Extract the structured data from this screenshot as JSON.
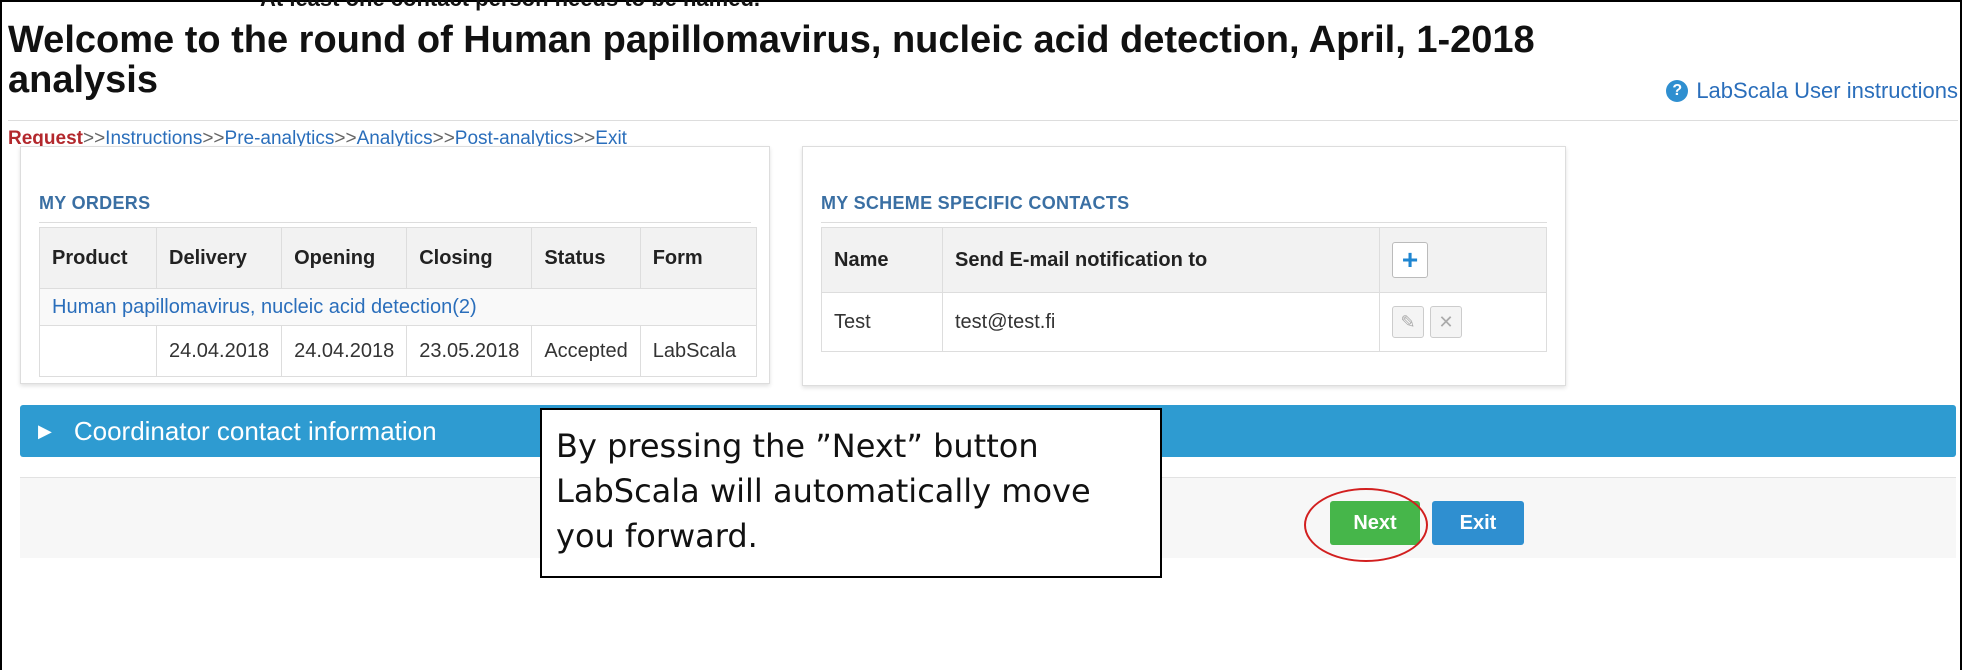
{
  "page": {
    "cut_note": "At least one contact person needs to be named.",
    "title": "Welcome to the round of Human papillomavirus, nucleic acid detection, April, 1-2018 analysis",
    "help_link": "LabScala User instructions"
  },
  "breadcrumb": {
    "active": "Request",
    "separator": ">>",
    "items": [
      "Instructions",
      "Pre-analytics",
      "Analytics",
      "Post-analytics",
      "Exit"
    ]
  },
  "orders": {
    "heading": "MY ORDERS",
    "columns": [
      "Product",
      "Delivery",
      "Opening",
      "Closing",
      "Status",
      "Form"
    ],
    "product_name": "Human papillomavirus, nucleic acid detection(2)",
    "rows": [
      {
        "product": "",
        "delivery": "24.04.2018",
        "opening": "24.04.2018",
        "closing": "23.05.2018",
        "status": "Accepted",
        "form": "LabScala"
      }
    ]
  },
  "contacts": {
    "heading": "MY SCHEME SPECIFIC CONTACTS",
    "columns": [
      "Name",
      "Send E-mail notification to"
    ],
    "rows": [
      {
        "name": "Test",
        "email": "test@test.fi"
      }
    ]
  },
  "coordinator": {
    "label": "Coordinator contact information"
  },
  "actions": {
    "next_label": "Next",
    "exit_label": "Exit"
  },
  "callout": {
    "text": "By pressing the ”Next” button LabScala will automatically move you forward."
  },
  "colors": {
    "accent_blue": "#2e9bd1",
    "next_green": "#46b64a",
    "active_red": "#b3282d",
    "highlight_ring": "#d21f1f"
  },
  "icons": {
    "help": "question-circle-icon",
    "add": "plus-icon",
    "edit": "pencil-icon",
    "delete": "x-icon",
    "expand": "triangle-right-icon"
  }
}
